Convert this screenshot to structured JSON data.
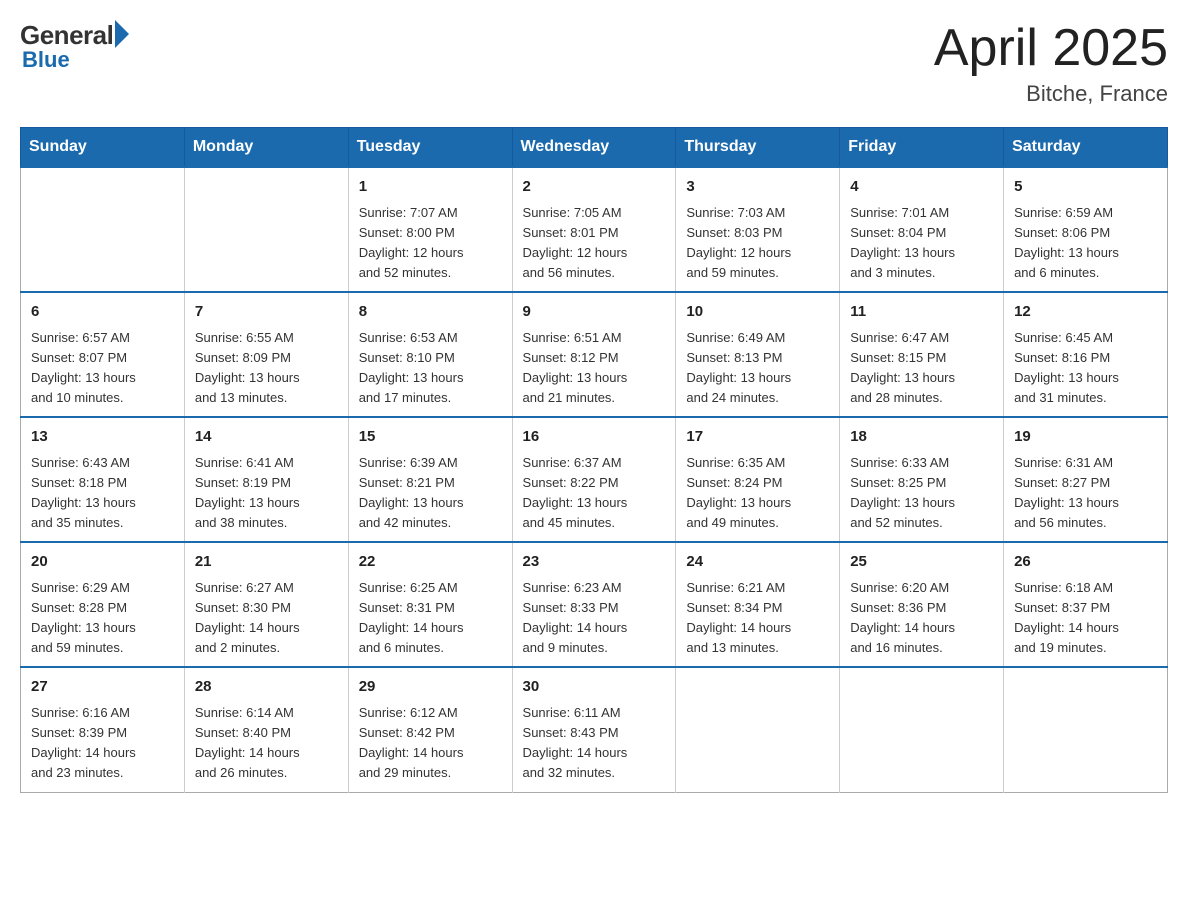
{
  "logo": {
    "general": "General",
    "blue": "Blue"
  },
  "header": {
    "month": "April 2025",
    "location": "Bitche, France"
  },
  "weekdays": [
    "Sunday",
    "Monday",
    "Tuesday",
    "Wednesday",
    "Thursday",
    "Friday",
    "Saturday"
  ],
  "weeks": [
    [
      {
        "day": "",
        "info": ""
      },
      {
        "day": "",
        "info": ""
      },
      {
        "day": "1",
        "info": "Sunrise: 7:07 AM\nSunset: 8:00 PM\nDaylight: 12 hours\nand 52 minutes."
      },
      {
        "day": "2",
        "info": "Sunrise: 7:05 AM\nSunset: 8:01 PM\nDaylight: 12 hours\nand 56 minutes."
      },
      {
        "day": "3",
        "info": "Sunrise: 7:03 AM\nSunset: 8:03 PM\nDaylight: 12 hours\nand 59 minutes."
      },
      {
        "day": "4",
        "info": "Sunrise: 7:01 AM\nSunset: 8:04 PM\nDaylight: 13 hours\nand 3 minutes."
      },
      {
        "day": "5",
        "info": "Sunrise: 6:59 AM\nSunset: 8:06 PM\nDaylight: 13 hours\nand 6 minutes."
      }
    ],
    [
      {
        "day": "6",
        "info": "Sunrise: 6:57 AM\nSunset: 8:07 PM\nDaylight: 13 hours\nand 10 minutes."
      },
      {
        "day": "7",
        "info": "Sunrise: 6:55 AM\nSunset: 8:09 PM\nDaylight: 13 hours\nand 13 minutes."
      },
      {
        "day": "8",
        "info": "Sunrise: 6:53 AM\nSunset: 8:10 PM\nDaylight: 13 hours\nand 17 minutes."
      },
      {
        "day": "9",
        "info": "Sunrise: 6:51 AM\nSunset: 8:12 PM\nDaylight: 13 hours\nand 21 minutes."
      },
      {
        "day": "10",
        "info": "Sunrise: 6:49 AM\nSunset: 8:13 PM\nDaylight: 13 hours\nand 24 minutes."
      },
      {
        "day": "11",
        "info": "Sunrise: 6:47 AM\nSunset: 8:15 PM\nDaylight: 13 hours\nand 28 minutes."
      },
      {
        "day": "12",
        "info": "Sunrise: 6:45 AM\nSunset: 8:16 PM\nDaylight: 13 hours\nand 31 minutes."
      }
    ],
    [
      {
        "day": "13",
        "info": "Sunrise: 6:43 AM\nSunset: 8:18 PM\nDaylight: 13 hours\nand 35 minutes."
      },
      {
        "day": "14",
        "info": "Sunrise: 6:41 AM\nSunset: 8:19 PM\nDaylight: 13 hours\nand 38 minutes."
      },
      {
        "day": "15",
        "info": "Sunrise: 6:39 AM\nSunset: 8:21 PM\nDaylight: 13 hours\nand 42 minutes."
      },
      {
        "day": "16",
        "info": "Sunrise: 6:37 AM\nSunset: 8:22 PM\nDaylight: 13 hours\nand 45 minutes."
      },
      {
        "day": "17",
        "info": "Sunrise: 6:35 AM\nSunset: 8:24 PM\nDaylight: 13 hours\nand 49 minutes."
      },
      {
        "day": "18",
        "info": "Sunrise: 6:33 AM\nSunset: 8:25 PM\nDaylight: 13 hours\nand 52 minutes."
      },
      {
        "day": "19",
        "info": "Sunrise: 6:31 AM\nSunset: 8:27 PM\nDaylight: 13 hours\nand 56 minutes."
      }
    ],
    [
      {
        "day": "20",
        "info": "Sunrise: 6:29 AM\nSunset: 8:28 PM\nDaylight: 13 hours\nand 59 minutes."
      },
      {
        "day": "21",
        "info": "Sunrise: 6:27 AM\nSunset: 8:30 PM\nDaylight: 14 hours\nand 2 minutes."
      },
      {
        "day": "22",
        "info": "Sunrise: 6:25 AM\nSunset: 8:31 PM\nDaylight: 14 hours\nand 6 minutes."
      },
      {
        "day": "23",
        "info": "Sunrise: 6:23 AM\nSunset: 8:33 PM\nDaylight: 14 hours\nand 9 minutes."
      },
      {
        "day": "24",
        "info": "Sunrise: 6:21 AM\nSunset: 8:34 PM\nDaylight: 14 hours\nand 13 minutes."
      },
      {
        "day": "25",
        "info": "Sunrise: 6:20 AM\nSunset: 8:36 PM\nDaylight: 14 hours\nand 16 minutes."
      },
      {
        "day": "26",
        "info": "Sunrise: 6:18 AM\nSunset: 8:37 PM\nDaylight: 14 hours\nand 19 minutes."
      }
    ],
    [
      {
        "day": "27",
        "info": "Sunrise: 6:16 AM\nSunset: 8:39 PM\nDaylight: 14 hours\nand 23 minutes."
      },
      {
        "day": "28",
        "info": "Sunrise: 6:14 AM\nSunset: 8:40 PM\nDaylight: 14 hours\nand 26 minutes."
      },
      {
        "day": "29",
        "info": "Sunrise: 6:12 AM\nSunset: 8:42 PM\nDaylight: 14 hours\nand 29 minutes."
      },
      {
        "day": "30",
        "info": "Sunrise: 6:11 AM\nSunset: 8:43 PM\nDaylight: 14 hours\nand 32 minutes."
      },
      {
        "day": "",
        "info": ""
      },
      {
        "day": "",
        "info": ""
      },
      {
        "day": "",
        "info": ""
      }
    ]
  ]
}
